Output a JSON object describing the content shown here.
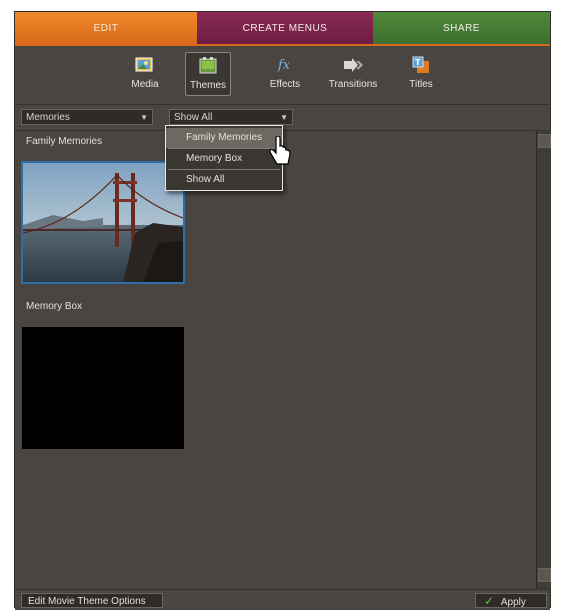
{
  "tabs": {
    "edit": "EDIT",
    "create_menus": "CREATE MENUS",
    "share": "SHARE"
  },
  "colors": {
    "edit_tab": "#e07a22",
    "create_menus_tab": "#7a2449",
    "share_tab": "#467d35",
    "panel_bg": "#4a4540",
    "selection_border": "#2f6fa8"
  },
  "toolbar": {
    "items": [
      {
        "label": "Media",
        "icon": "media-icon"
      },
      {
        "label": "Themes",
        "icon": "themes-icon",
        "active": true
      },
      {
        "label": "Effects",
        "icon": "effects-icon"
      },
      {
        "label": "Transitions",
        "icon": "transitions-icon"
      },
      {
        "label": "Titles",
        "icon": "titles-icon"
      }
    ]
  },
  "filters": {
    "category_value": "Memories",
    "view_value": "Show All"
  },
  "dropdown": {
    "items": [
      "Family Memories",
      "Memory Box",
      "Show All"
    ],
    "highlighted_index": 0
  },
  "content": {
    "sections": [
      {
        "label": "Family Memories",
        "thumbnail": "golden-gate-bridge-photo",
        "selected": true
      },
      {
        "label": "Memory Box",
        "thumbnail": "black-thumbnail",
        "selected": false
      }
    ]
  },
  "bottom": {
    "edit_options_label": "Edit Movie Theme Options",
    "apply_label": "Apply"
  }
}
